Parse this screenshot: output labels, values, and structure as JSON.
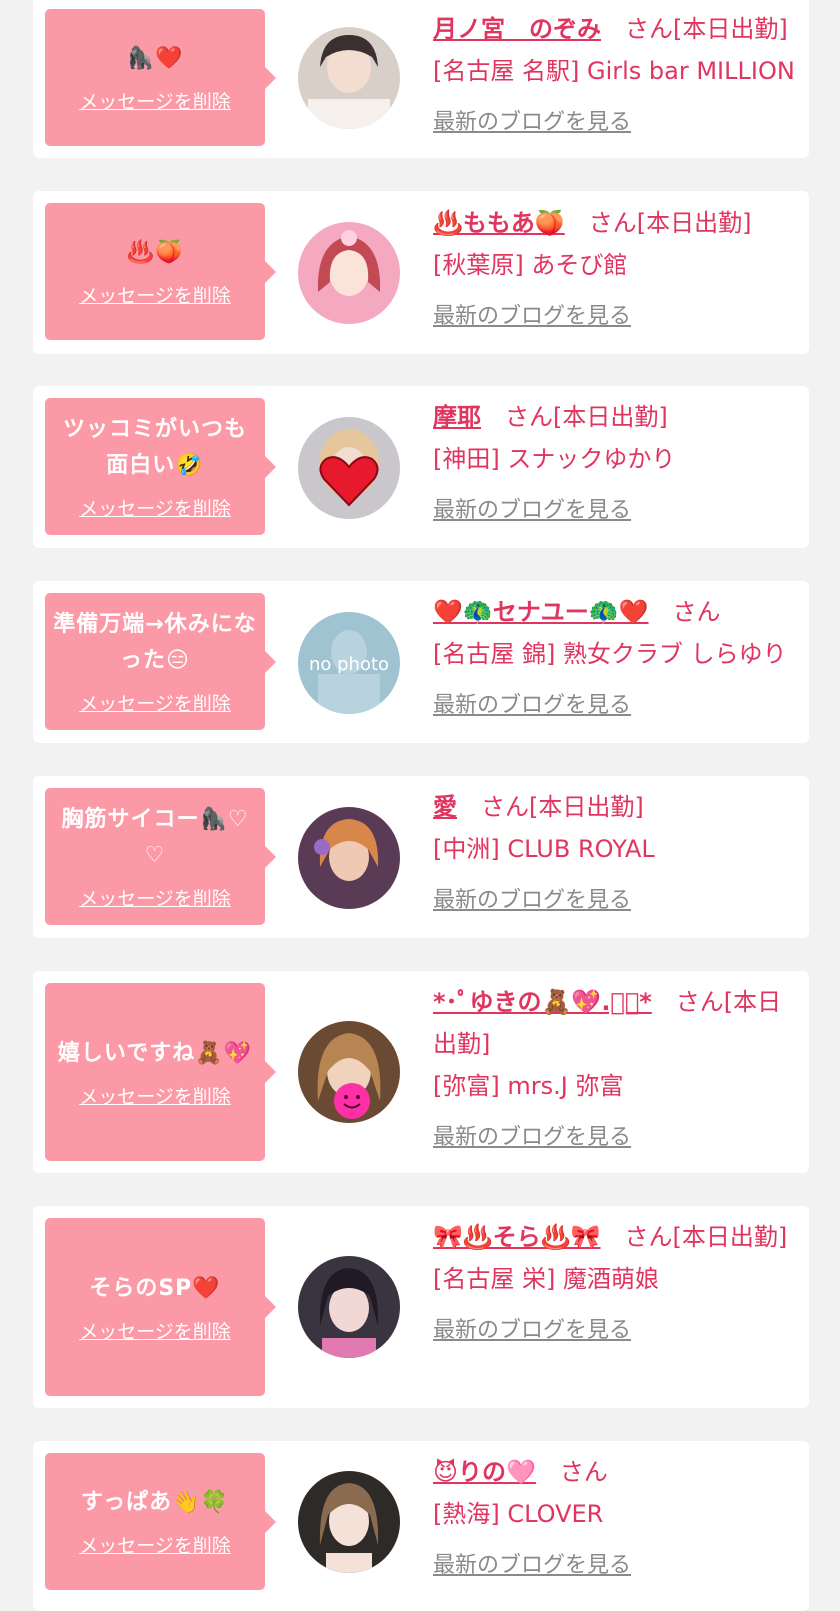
{
  "delete_label": "メッセージを削除",
  "blog_label": "最新のブログを見る",
  "colors": {
    "bubble": "#fc99a6",
    "accent": "#e0355f",
    "link_gray": "#8a8a8a"
  },
  "cards": [
    {
      "message": "🦍❤️",
      "name": "月ノ宮　のぞみ",
      "suffix": "さん[本日出勤]",
      "shop": "[名古屋 名駅] Girls bar MILLION",
      "avatar_icon": "profile-photo"
    },
    {
      "message": "♨️🍑",
      "name": "♨️ももあ🍑",
      "suffix": "さん[本日出勤]",
      "shop": "[秋葉原] あそび館",
      "avatar_icon": "profile-photo"
    },
    {
      "message": "ツッコミがいつも面白い🤣",
      "name": "摩耶",
      "suffix": "さん[本日出勤]",
      "shop": "[神田] スナックゆかり",
      "avatar_icon": "profile-photo-heart-sticker"
    },
    {
      "message": "準備万端→休みになった😑",
      "name": "❤️🦚セナユー🦚❤️",
      "suffix": "さん",
      "shop": "[名古屋 錦] 熟女クラブ しらゆり",
      "avatar_icon": "no-photo",
      "avatar_text": "no photo"
    },
    {
      "message": "胸筋サイコー🦍♡♡",
      "name": "愛",
      "suffix": "さん[本日出勤]",
      "shop": "[中洲] CLUB ROYAL",
      "avatar_icon": "profile-photo"
    },
    {
      "message": "嬉しいですね🧸💖",
      "name": "*･ﾟゆきの🧸💖.ﾟ･*",
      "suffix": "さん[本日出勤]",
      "shop": "[弥富] mrs.J 弥富",
      "avatar_icon": "profile-photo-smile-sticker"
    },
    {
      "message": "そらのSP❤️",
      "name": "🎀♨️そら♨️🎀",
      "suffix": "さん[本日出勤]",
      "shop": "[名古屋 栄] 魔酒萌娘",
      "avatar_icon": "profile-photo"
    },
    {
      "message": "すっぱあ👋🍀",
      "name": "😈りの🩷",
      "suffix": "さん",
      "shop": "[熱海] CLOVER",
      "avatar_icon": "profile-photo"
    }
  ]
}
